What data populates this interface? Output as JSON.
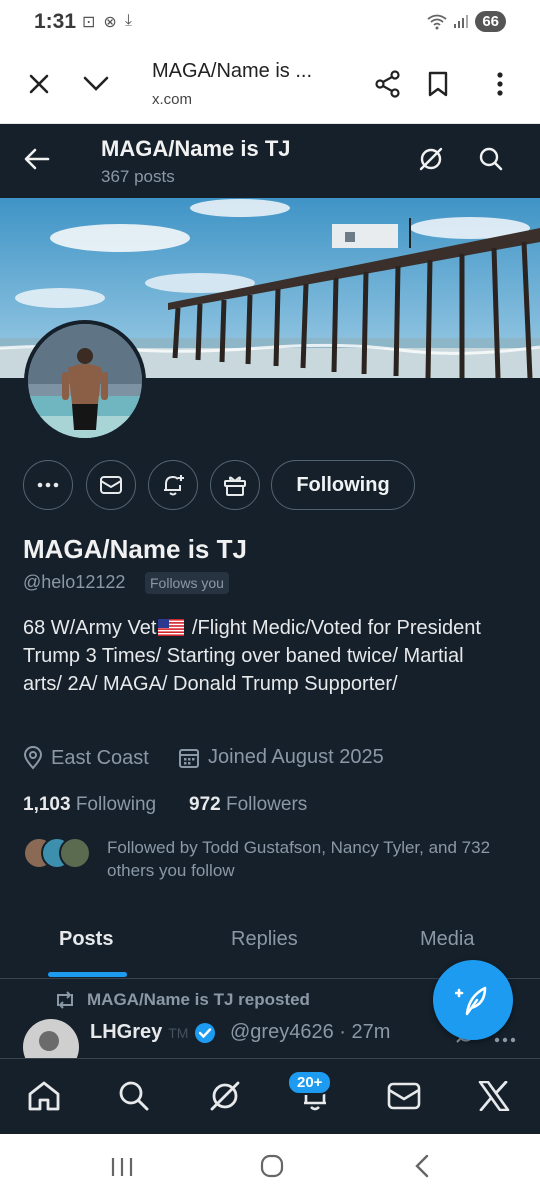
{
  "status_bar": {
    "time": "1:31",
    "battery": "66"
  },
  "browser": {
    "title": "MAGA/Name is ...",
    "url": "x.com"
  },
  "header": {
    "name": "MAGA/Name is TJ",
    "posts_count": "367 posts"
  },
  "profile": {
    "display_name": "MAGA/Name is TJ",
    "handle": "@helo12122",
    "follows_you": "Follows you",
    "bio_part1": "68 W/Army Vet",
    "bio_part2": " /Flight Medic/Voted for President Trump 3 Times/ Starting over baned twice/ Martial arts/ 2A/ MAGA/ Donald Trump Supporter/",
    "location": "East Coast",
    "joined": "Joined August 2025",
    "following_count": "1,103",
    "following_label": "Following",
    "followers_count": "972",
    "followers_label": "Followers",
    "followed_by": "Followed by Todd Gustafson, Nancy Tyler, and 732 others you follow"
  },
  "actions": {
    "following_button": "Following"
  },
  "tabs": [
    {
      "label": "Posts"
    },
    {
      "label": "Replies"
    },
    {
      "label": "Media"
    }
  ],
  "feed": {
    "repost_label": "MAGA/Name is TJ reposted",
    "tweet_name": "LHGrey",
    "tweet_name_suffix": "TM",
    "tweet_meta": "@grey4626 · 27m"
  },
  "bottom_nav": {
    "notifications_badge": "20+"
  },
  "colors": {
    "background": "#15202b",
    "accent": "#1d9bf0",
    "muted": "#8b98a5",
    "border": "#536471"
  }
}
